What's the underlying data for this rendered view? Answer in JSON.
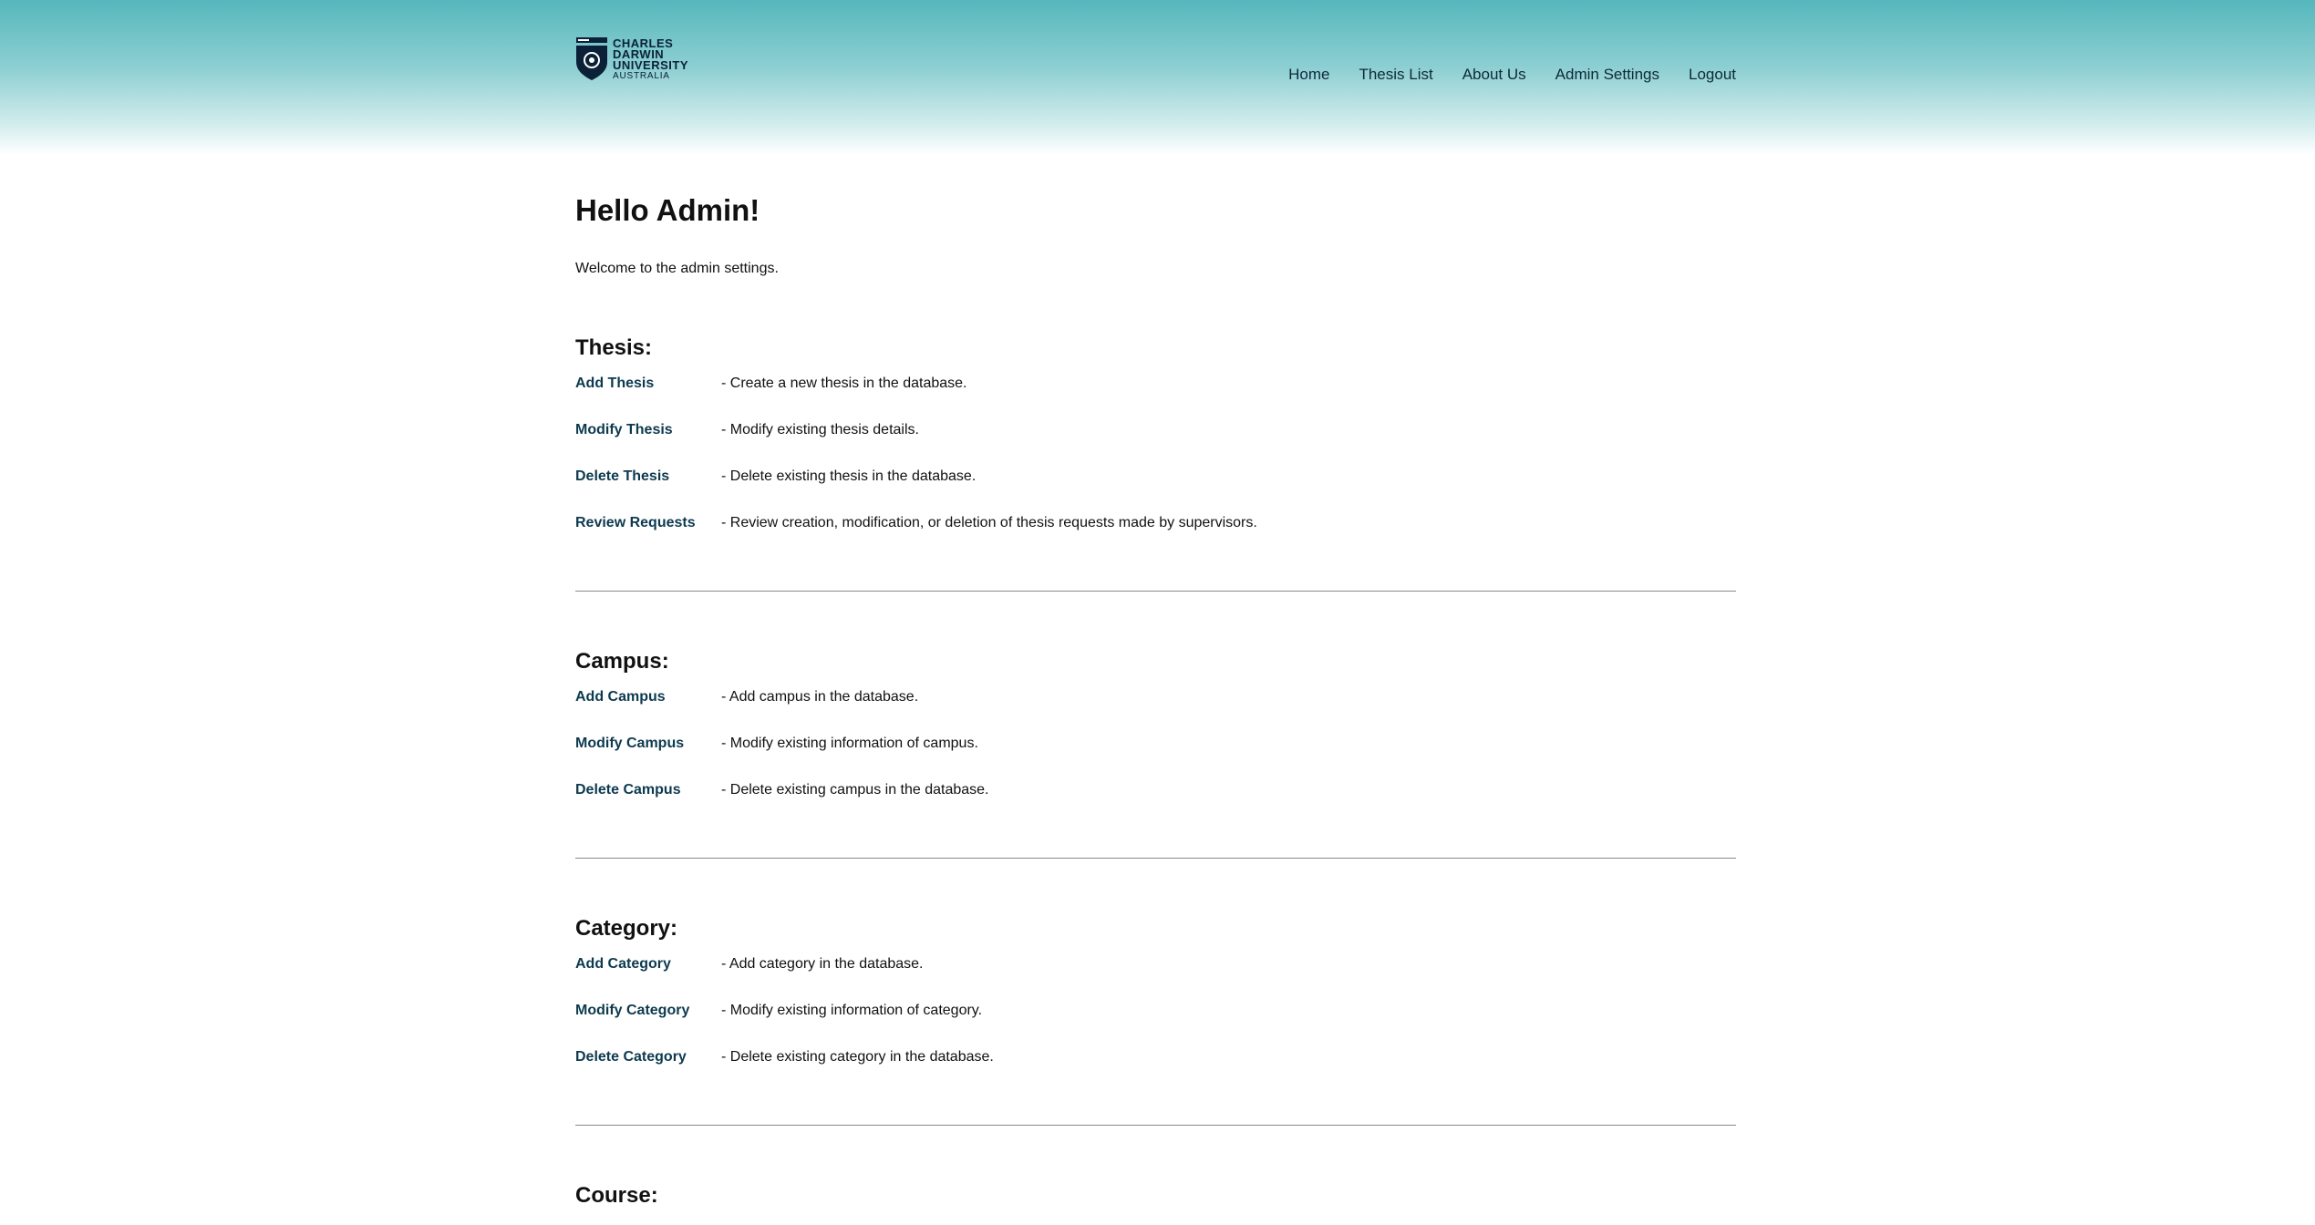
{
  "logo": {
    "line1": "CHARLES",
    "line2": "DARWIN",
    "line3": "UNIVERSITY",
    "line4": "AUSTRALIA"
  },
  "nav": {
    "items": [
      "Home",
      "Thesis List",
      "About Us",
      "Admin Settings",
      "Logout"
    ]
  },
  "greeting": "Hello Admin!",
  "welcome": "Welcome to the admin settings.",
  "sections": {
    "thesis": {
      "title": "Thesis:",
      "rows": [
        {
          "link": "Add Thesis",
          "desc": "- Create a new thesis in the database."
        },
        {
          "link": "Modify Thesis",
          "desc": "- Modify existing thesis details."
        },
        {
          "link": "Delete Thesis",
          "desc": "- Delete existing thesis in the database."
        },
        {
          "link": "Review Requests",
          "desc": "- Review creation, modification, or deletion of thesis requests made by supervisors."
        }
      ]
    },
    "campus": {
      "title": "Campus:",
      "rows": [
        {
          "link": "Add Campus",
          "desc": "- Add campus in the database."
        },
        {
          "link": "Modify Campus",
          "desc": "- Modify existing information of campus."
        },
        {
          "link": "Delete Campus",
          "desc": "- Delete existing campus in the database."
        }
      ]
    },
    "category": {
      "title": "Category:",
      "rows": [
        {
          "link": "Add Category",
          "desc": "- Add category in the database."
        },
        {
          "link": "Modify Category",
          "desc": "- Modify existing information of category."
        },
        {
          "link": "Delete Category",
          "desc": "- Delete existing category in the database."
        }
      ]
    },
    "course": {
      "title": "Course:"
    }
  },
  "colors": {
    "header_top": "#55b7bc",
    "link": "#0d3a4f",
    "logo_navy": "#0b2138"
  }
}
